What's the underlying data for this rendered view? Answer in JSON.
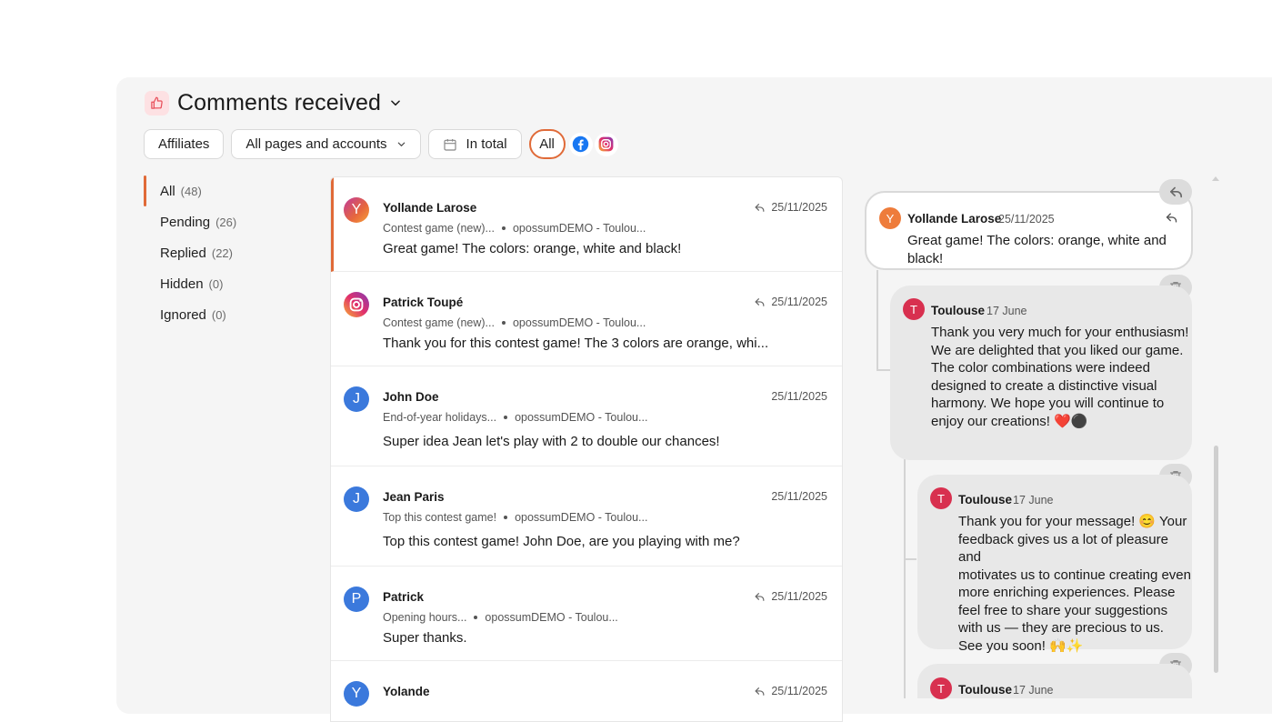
{
  "header": {
    "title": "Comments received"
  },
  "filters": {
    "affiliates": "Affiliates",
    "pages": "All pages and accounts",
    "period": "In total",
    "network_all": "All"
  },
  "nav": [
    {
      "label": "All",
      "count": "(48)"
    },
    {
      "label": "Pending",
      "count": "(26)"
    },
    {
      "label": "Replied",
      "count": "(22)"
    },
    {
      "label": "Hidden",
      "count": "(0)"
    },
    {
      "label": "Ignored",
      "count": "(0)"
    }
  ],
  "comments": [
    {
      "initial": "Y",
      "name": "Yollande Larose",
      "post": "Contest game (new)...",
      "account": "opossumDEMO - Toulou...",
      "text": "Great game! The colors: orange, white and black!",
      "date": "25/11/2025"
    },
    {
      "initial": "",
      "name": "Patrick Toupé",
      "post": "Contest game (new)...",
      "account": "opossumDEMO - Toulou...",
      "text": "Thank you for this contest game! The 3 colors are orange, whi...",
      "date": "25/11/2025"
    },
    {
      "initial": "J",
      "name": "John Doe",
      "post": "End-of-year holidays...",
      "account": "opossumDEMO - Toulou...",
      "text": "Super idea Jean let's play with 2 to double our chances!",
      "date": "25/11/2025"
    },
    {
      "initial": "J",
      "name": "Jean Paris",
      "post": "Top this contest game!",
      "account": "opossumDEMO - Toulou...",
      "text": "Top this contest game! John Doe, are you playing with me?",
      "date": "25/11/2025"
    },
    {
      "initial": "P",
      "name": "Patrick",
      "post": "Opening hours...",
      "account": "opossumDEMO - Toulou...",
      "text": "Super thanks.",
      "date": "25/11/2025"
    },
    {
      "initial": "Y",
      "name": "Yolande",
      "date": "25/11/2025"
    }
  ],
  "thread": {
    "original": {
      "initial": "Y",
      "name": "Yollande Larose",
      "date": "25/11/2025",
      "text": "Great game! The colors: orange, white and black!"
    },
    "replies": [
      {
        "initial": "T",
        "name": "Toulouse",
        "date": "17 June",
        "lines": [
          "Thank you very much for your enthusiasm!",
          "We are delighted that you liked our game.",
          "The color combinations were indeed",
          "designed to create a distinctive visual",
          "harmony. We hope you will continue to",
          "enjoy our creations! ❤️⚫"
        ]
      },
      {
        "initial": "T",
        "name": "Toulouse",
        "date": "17 June",
        "lines": [
          "Thank you for your message! 😊 Your",
          "feedback gives us a lot of pleasure and",
          "motivates us to continue creating even",
          "more enriching experiences. Please",
          "feel free to share your suggestions",
          "with us — they are precious to us.",
          "See you soon! 🙌✨"
        ]
      },
      {
        "initial": "T",
        "name": "Toulouse",
        "date": "17 June"
      }
    ]
  },
  "colors": {
    "accent": "#e06a38",
    "facebook": "#1877f2",
    "instagram": "#d62976",
    "toulouse": "#d8304f"
  }
}
